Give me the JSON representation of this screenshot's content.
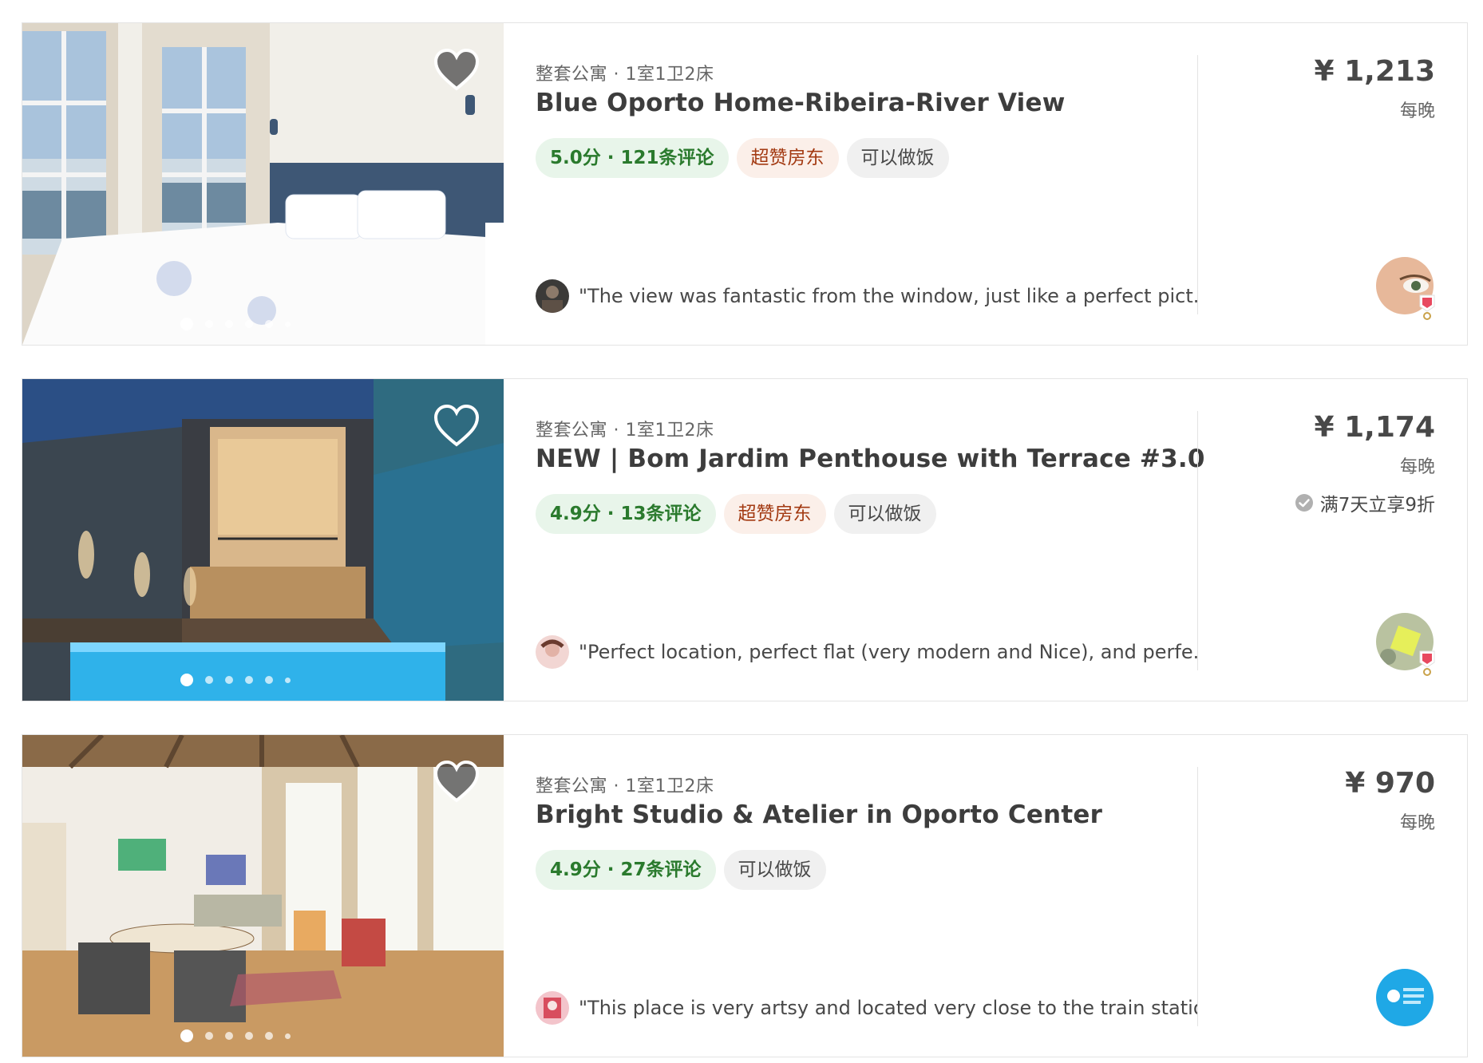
{
  "listings": [
    {
      "meta": "整套公寓 · 1室1卫2床",
      "title": "Blue Oporto Home-Ribeira-River View",
      "rating_tag": "5.0分 · 121条评论",
      "superhost_tag": "超赞房东",
      "cook_tag": "可以做饭",
      "review": "\"The view was fantastic from the window, just like a perfect pict... \"",
      "price": "¥ 1,213",
      "per_night": "每晚",
      "discount": "",
      "favorited": true,
      "photo_count": 6,
      "active_photo": 1
    },
    {
      "meta": "整套公寓 · 1室1卫2床",
      "title": "NEW | Bom Jardim Penthouse with Terrace #3.0",
      "rating_tag": "4.9分 · 13条评论",
      "superhost_tag": "超赞房东",
      "cook_tag": "可以做饭",
      "review": "\"Perfect location, perfect flat (very modern and Nice), and perfe... \"",
      "price": "¥ 1,174",
      "per_night": "每晚",
      "discount": "满7天立享9折",
      "favorited": false,
      "photo_count": 6,
      "active_photo": 1
    },
    {
      "meta": "整套公寓 · 1室1卫2床",
      "title": "Bright Studio & Atelier in Oporto Center",
      "rating_tag": "4.9分 · 27条评论",
      "superhost_tag": "",
      "cook_tag": "可以做饭",
      "review": "\"This place is very artsy and located very close to the train statio... \"",
      "price": "¥ 970",
      "per_night": "每晚",
      "discount": "",
      "favorited": true,
      "photo_count": 6,
      "active_photo": 1
    }
  ],
  "colors": {
    "rating_bg": "#e8f5ea",
    "rating_text": "#2a7a2d",
    "superhost_bg": "#fbefe9",
    "superhost_text": "#a33a12",
    "neutral_tag_bg": "#f0f0f0",
    "border": "#e4e4e4"
  },
  "icons": {
    "favorite": "heart-icon",
    "discount": "check-circle-icon",
    "superhost_badge": "superhost-badge-icon"
  }
}
